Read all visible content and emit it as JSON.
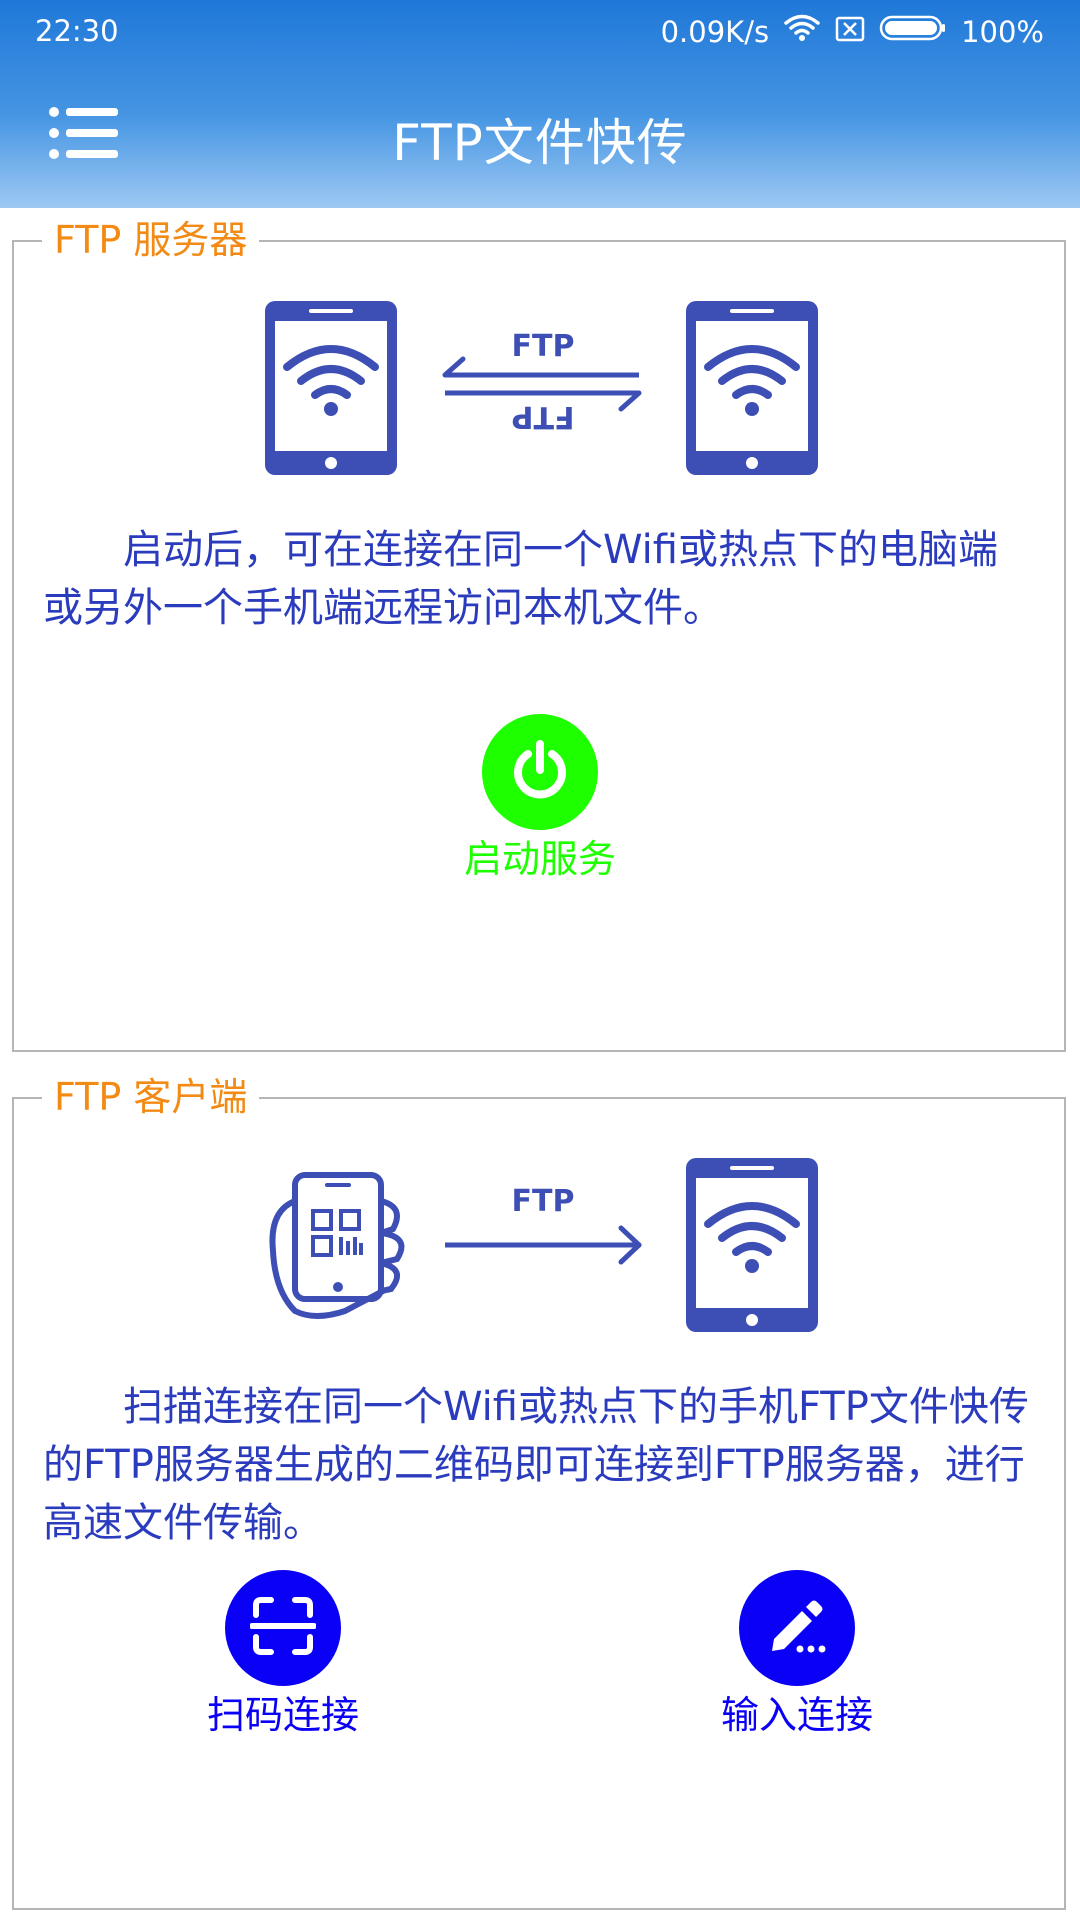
{
  "status_bar": {
    "time": "22:30",
    "speed": "0.09K/s",
    "battery": "100%",
    "icons": [
      "wifi-icon",
      "sim-icon",
      "battery-icon"
    ]
  },
  "app_bar": {
    "title": "FTP文件快传",
    "menu_icon": "menu-icon"
  },
  "server": {
    "legend": "FTP 服务器",
    "arrow_label_top": "FTP",
    "arrow_label_bottom": "FTP",
    "description": "启动后，可在连接在同一个Wifi或热点下的电脑端或另外一个手机端远程访问本机文件。",
    "start_button_label": "启动服务"
  },
  "client": {
    "legend": "FTP 客户端",
    "arrow_label": "FTP",
    "description": "扫描连接在同一个Wifi或热点下的手机FTP文件快传的FTP服务器生成的二维码即可连接到FTP服务器，进行高速文件传输。",
    "scan_button_label": "扫码连接",
    "input_button_label": "输入连接"
  },
  "colors": {
    "accent_orange": "#f28a13",
    "text_blue": "#2b3bbd",
    "illustration_blue": "#3d4fb5",
    "start_green": "#1eff00",
    "button_blue": "#0a00f5"
  }
}
